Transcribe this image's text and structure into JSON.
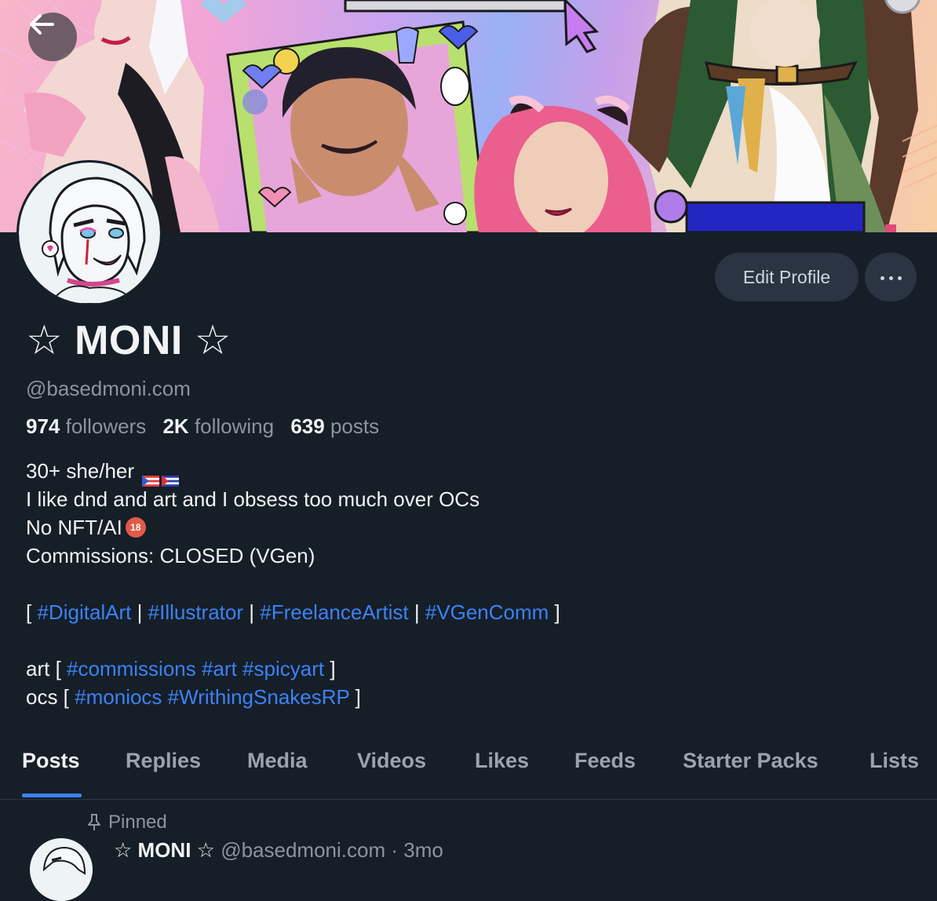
{
  "profile": {
    "display_name": "☆ MONI ☆",
    "handle": "@basedmoni.com",
    "stats": {
      "followers_count": "974",
      "followers_label": "followers",
      "following_count": "2K",
      "following_label": "following",
      "posts_count": "639",
      "posts_label": "posts"
    },
    "bio": {
      "line1": "30+ she/her",
      "line2": "I like dnd and art and I obsess too much over OCs",
      "line3": "No NFT/AI",
      "line4": "Commissions: CLOSED (VGen)",
      "tags_open": "[",
      "tags_sep": "|",
      "tags_close": "]",
      "tags": [
        "#DigitalArt",
        "#Illustrator",
        "#FreelanceArtist",
        "#VGenComm"
      ],
      "art_prefix": "art [",
      "art_tags": [
        "#commissions",
        "#art",
        "#spicyart"
      ],
      "art_suffix": "]",
      "ocs_prefix": "ocs [",
      "ocs_tags": [
        "#moniocs",
        "#WrithingSnakesRP"
      ],
      "ocs_suffix": "]",
      "no18_badge": "18"
    }
  },
  "actions": {
    "edit_profile_label": "Edit Profile",
    "more_icon": "ellipsis-icon",
    "back_icon": "arrow-left-icon"
  },
  "tabs": [
    {
      "label": "Posts",
      "active": true
    },
    {
      "label": "Replies"
    },
    {
      "label": "Media"
    },
    {
      "label": "Videos"
    },
    {
      "label": "Likes"
    },
    {
      "label": "Feeds"
    },
    {
      "label": "Starter Packs"
    },
    {
      "label": "Lists"
    }
  ],
  "pinned_post": {
    "pinned_label": "Pinned",
    "author_name": "☆ MONI ☆",
    "author_handle": "@basedmoni.com",
    "separator": "·",
    "time": "3mo"
  },
  "colors": {
    "background": "#161e27",
    "link": "#3b82f6",
    "muted": "#8b95a3",
    "button_bg": "#2a3442"
  }
}
